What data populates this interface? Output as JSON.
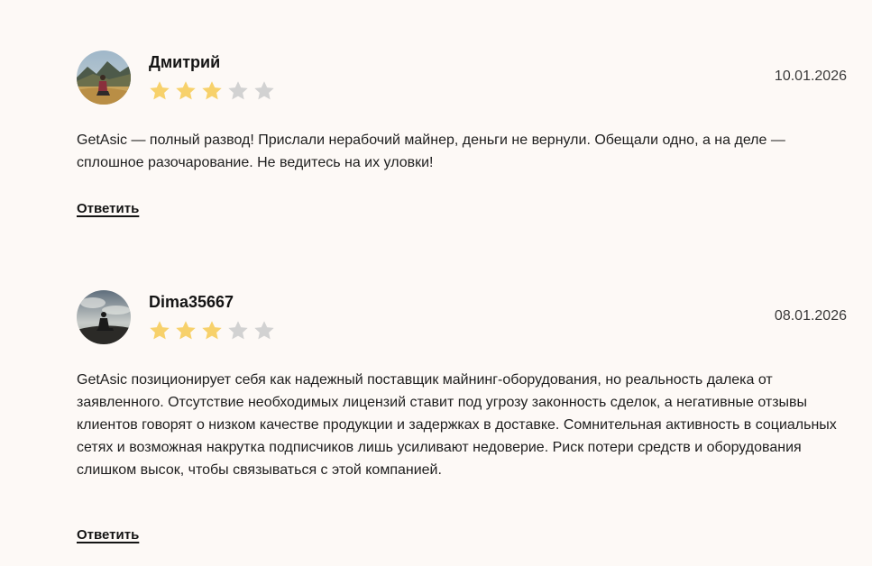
{
  "colors": {
    "background": "#fdf9f6",
    "star_filled": "#f7d16b",
    "star_empty": "#d2d2d2"
  },
  "reviews": [
    {
      "author": "Дмитрий",
      "date": "10.01.2026",
      "rating": 3,
      "max_rating": 5,
      "text": "GetAsic — полный развод! Прислали нерабочий майнер, деньги не вернули. Обещали одно, а на деле — сплошное разочарование. Не ведитесь на их уловки!",
      "reply_label": "Ответить"
    },
    {
      "author": "Dima35667",
      "date": "08.01.2026",
      "rating": 3,
      "max_rating": 5,
      "text": "GetAsic позиционирует себя как надежный поставщик майнинг-оборудования, но реальность далека от заявленного. Отсутствие необходимых лицензий ставит под угрозу законность сделок, а негативные отзывы клиентов говорят о низком качестве продукции и задержках в доставке. Сомнительная активность в социальных сетях и возможная накрутка подписчиков лишь усиливают недоверие. Риск потери средств и оборудования слишком высок, чтобы связываться с этой компанией.",
      "reply_label": "Ответить"
    }
  ]
}
